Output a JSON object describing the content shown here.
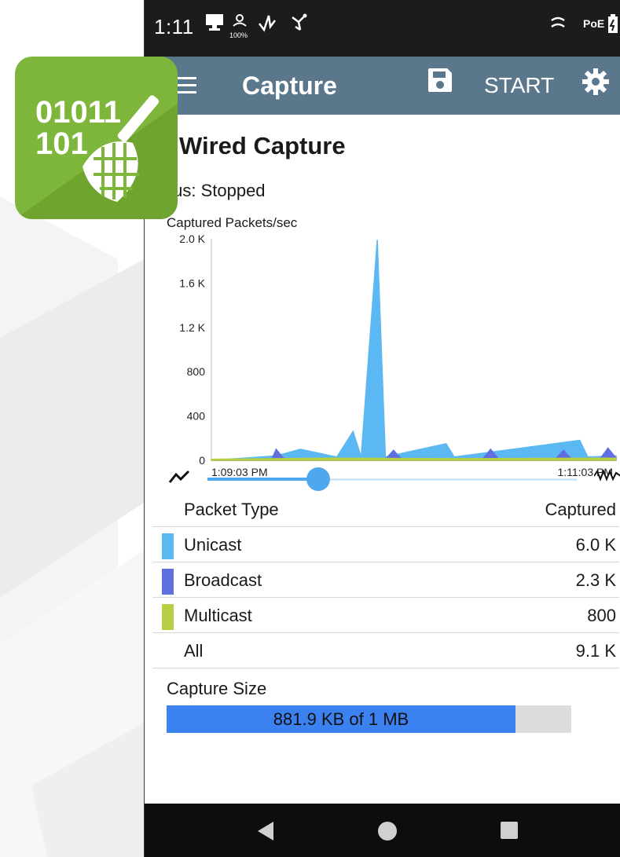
{
  "status_bar": {
    "time": "1:11",
    "battery_sub": "100%",
    "poe_label": "PoE",
    "icons": [
      "monitor-icon",
      "person-icon",
      "signal-icon",
      "usb-icon",
      "cable-icon",
      "battery-icon"
    ]
  },
  "app_bar": {
    "title": "Capture",
    "start_label": "START",
    "icons": [
      "menu-icon",
      "save-icon",
      "gear-icon"
    ]
  },
  "app_icon": {
    "digits_line1": "01011",
    "digits_line2": "101",
    "icon": "net-capture-icon",
    "color": "#7db63a"
  },
  "page": {
    "title_visible": "Wired Capture",
    "status_visible": "tus:  Stopped"
  },
  "chart_data": {
    "type": "area",
    "title": "Captured Packets/sec",
    "ylim": [
      0,
      2000
    ],
    "y_ticks": [
      "2.0 K",
      "1.6 K",
      "1.2 K",
      "800",
      "400",
      "0"
    ],
    "x_ticks": [
      "1:09:03 PM",
      "1:11:03 PM"
    ],
    "series": [
      {
        "name": "Unicast",
        "color": "#5cb8f2",
        "points": [
          [
            0,
            0
          ],
          [
            0.08,
            20
          ],
          [
            0.16,
            40
          ],
          [
            0.22,
            100
          ],
          [
            0.31,
            30
          ],
          [
            0.35,
            260
          ],
          [
            0.37,
            30
          ],
          [
            0.41,
            1990
          ],
          [
            0.43,
            30
          ],
          [
            0.58,
            150
          ],
          [
            0.6,
            30
          ],
          [
            0.91,
            180
          ],
          [
            0.93,
            30
          ],
          [
            1,
            40
          ]
        ]
      },
      {
        "name": "Broadcast",
        "color": "#5f6fe0",
        "points": [
          [
            0,
            0
          ],
          [
            0.15,
            15
          ],
          [
            0.16,
            100
          ],
          [
            0.18,
            10
          ],
          [
            0.43,
            10
          ],
          [
            0.45,
            90
          ],
          [
            0.47,
            10
          ],
          [
            0.67,
            10
          ],
          [
            0.69,
            100
          ],
          [
            0.71,
            10
          ],
          [
            0.85,
            10
          ],
          [
            0.87,
            90
          ],
          [
            0.89,
            10
          ],
          [
            0.96,
            10
          ],
          [
            0.98,
            110
          ],
          [
            1,
            20
          ]
        ]
      },
      {
        "name": "Multicast",
        "color": "#b6cf45",
        "points": [
          [
            0,
            10
          ],
          [
            0.3,
            20
          ],
          [
            0.6,
            15
          ],
          [
            1,
            20
          ]
        ]
      }
    ]
  },
  "slider": {
    "value": 0.3,
    "left_icon": "trend-icon",
    "right_icon": "waveform-icon"
  },
  "table": {
    "header": {
      "type": "Packet Type",
      "captured": "Captured"
    },
    "rows": [
      {
        "label": "Unicast",
        "value": "6.0 K",
        "color": "#5cb8f2"
      },
      {
        "label": "Broadcast",
        "value": "2.3 K",
        "color": "#5f6fe0"
      },
      {
        "label": "Multicast",
        "value": "800",
        "color": "#b6cf45"
      },
      {
        "label": "All",
        "value": "9.1 K",
        "color": ""
      }
    ]
  },
  "capture_size": {
    "label": "Capture Size",
    "text": "881.9 KB of 1 MB",
    "fraction": 0.862,
    "fill_color": "#3b82f0"
  },
  "nav": {
    "icons": [
      "back-icon",
      "home-icon",
      "recents-icon"
    ]
  }
}
